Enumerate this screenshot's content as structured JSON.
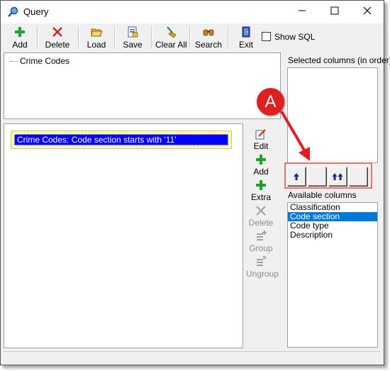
{
  "window": {
    "title": "Query",
    "icon": "magnifier-icon"
  },
  "toolbar": {
    "buttons": [
      {
        "label": "Add",
        "icon": "plus-icon"
      },
      {
        "label": "Delete",
        "icon": "x-icon"
      },
      {
        "label": "Load",
        "icon": "folder-open-icon"
      },
      {
        "label": "Save",
        "icon": "save-document-icon"
      },
      {
        "label": "Clear All",
        "icon": "broom-icon"
      },
      {
        "label": "Search",
        "icon": "binoculars-icon"
      },
      {
        "label": "Exit",
        "icon": "exit-door-icon"
      }
    ],
    "show_sql_label": "Show SQL",
    "show_sql_checked": false
  },
  "tables_tree": {
    "root": "Crime Codes"
  },
  "conditions": [
    "Crime Codes: Code section starts with '11'"
  ],
  "condition_actions": [
    {
      "label": "Edit",
      "icon": "edit-pencil-icon",
      "enabled": true
    },
    {
      "label": "Add",
      "icon": "plus-icon",
      "enabled": true
    },
    {
      "label": "Extra",
      "icon": "plus-icon",
      "enabled": true
    },
    {
      "label": "Delete",
      "icon": "x-icon",
      "enabled": false
    },
    {
      "label": "Group",
      "icon": "group-icon",
      "enabled": false
    },
    {
      "label": "Ungroup",
      "icon": "ungroup-icon",
      "enabled": false
    }
  ],
  "selected_columns": {
    "label": "Selected columns (in order)",
    "items": []
  },
  "move_buttons": [
    {
      "icon": "arrow-up-icon"
    },
    {
      "icon": "blank"
    },
    {
      "icon": "double-arrow-up-icon"
    },
    {
      "icon": "blank"
    }
  ],
  "available_columns": {
    "label": "Available columns",
    "items": [
      "Classification",
      "Code section",
      "Code type",
      "Description"
    ],
    "selected_index": 1
  },
  "annotation": {
    "marker": "A",
    "color": "#e02020"
  },
  "colors": {
    "condition_bg": "#ffffa0",
    "condition_selected": "#0000ff",
    "list_selected": "#0078d7"
  }
}
